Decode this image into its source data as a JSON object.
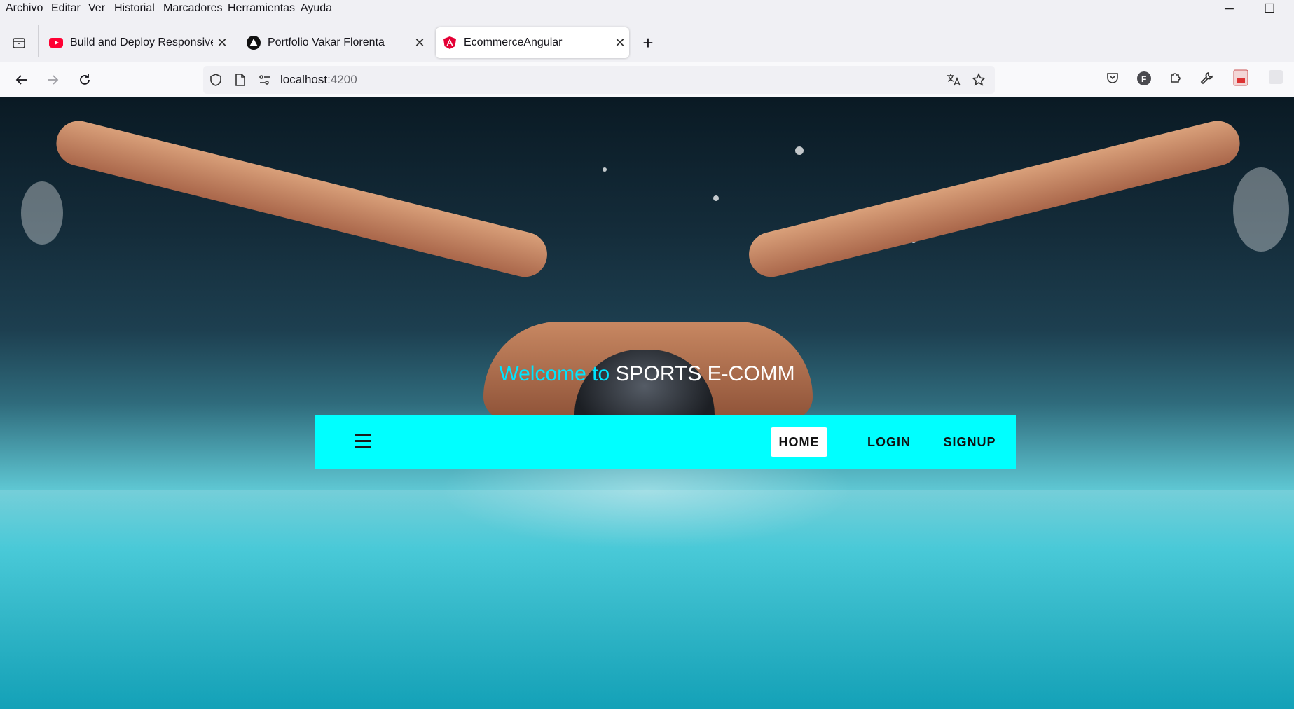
{
  "menubar": {
    "items": [
      "Archivo",
      "Editar",
      "Ver",
      "Historial",
      "Marcadores",
      "Herramientas",
      "Ayuda"
    ],
    "minimize": "─",
    "maximize": "☐"
  },
  "tabs": [
    {
      "title": "Build and Deploy Responsive Re",
      "favicon": "youtube-icon",
      "active": false
    },
    {
      "title": "Portfolio Vakar Florenta",
      "favicon": "triangle-logo-icon",
      "active": false
    },
    {
      "title": "EcommerceAngular",
      "favicon": "angular-icon",
      "active": true
    }
  ],
  "tab_close_glyph": "✕",
  "new_tab_glyph": "+",
  "address": {
    "host": "localhost",
    "port": ":4200"
  },
  "page": {
    "welcome_prefix": "Welcome to ",
    "welcome_brand": "SPORTS E-COMM",
    "nav": {
      "home": "HOME",
      "login": "LOGIN",
      "signup": "SIGNUP"
    }
  },
  "colors": {
    "nav_background": "#00ffff",
    "welcome_accent": "#00e5ff",
    "youtube_red": "#ff0033",
    "angular_pink": "#e40035"
  }
}
